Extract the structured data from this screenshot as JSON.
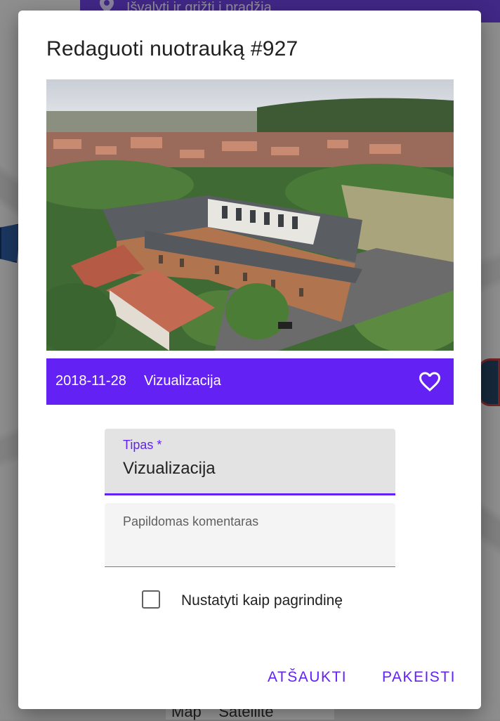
{
  "background": {
    "topbar_text": "Išvalyti ir grįžti į pradžią",
    "maptype_text": "Map    Satellite"
  },
  "dialog": {
    "title": "Redaguoti nuotrauką #927",
    "photo": {
      "date": "2018-11-28",
      "type": "Vizualizacija",
      "favorite": false
    },
    "type_field": {
      "label": "Tipas *",
      "value": "Vizualizacija"
    },
    "comment_field": {
      "placeholder": "Papildomas komentaras",
      "value": ""
    },
    "main_checkbox": {
      "label": "Nustatyti kaip pagrindinę",
      "checked": false
    },
    "cancel_label": "ATŠAUKTI",
    "save_label": "PAKEISTI"
  },
  "colors": {
    "accent": "#6321f4",
    "caption_bg": "#6321f4",
    "field_bg": "#e3e3e3"
  },
  "icons": [
    "location-pin-icon",
    "heart-icon",
    "checkbox-icon"
  ]
}
